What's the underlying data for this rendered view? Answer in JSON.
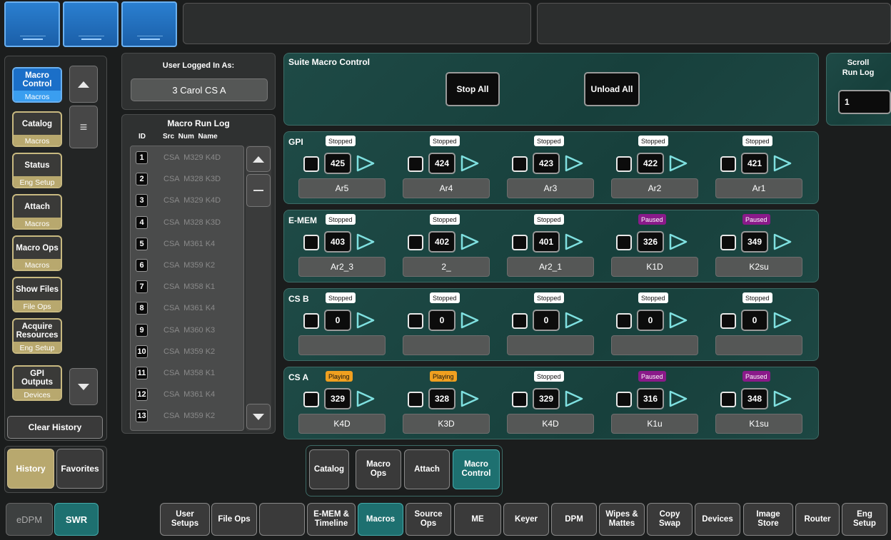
{
  "user_panel": {
    "title": "User Logged In As:",
    "user": "3 Carol  CS A"
  },
  "suite": {
    "title": "Suite Macro Control",
    "stop_all": "Stop All",
    "unload_all": "Unload All"
  },
  "scroll": {
    "title_1": "Scroll",
    "title_2": "Run Log",
    "value": "1"
  },
  "side_nav": [
    {
      "top": "Macro Control",
      "bottom": "Macros"
    },
    {
      "top": "Catalog",
      "bottom": "Macros"
    },
    {
      "top": "Status",
      "bottom": "Eng Setup"
    },
    {
      "top": "Attach",
      "bottom": "Macros"
    },
    {
      "top": "Macro Ops",
      "bottom": "Macros"
    },
    {
      "top": "Show Files",
      "bottom": "File Ops"
    },
    {
      "top": "Acquire Resources",
      "bottom": "Eng Setup"
    },
    {
      "top": "GPI Outputs",
      "bottom": "Devices"
    }
  ],
  "clear_history": "Clear History",
  "history_tab": "History",
  "favorites_tab": "Favorites",
  "mode": {
    "edpm": "eDPM",
    "swr": "SWR"
  },
  "log": {
    "title": "Macro Run Log",
    "col_id": "ID",
    "col_src_num_name": "Src  Num  Name",
    "rows": [
      {
        "id": "1",
        "text": "CSA  M329 K4D"
      },
      {
        "id": "2",
        "text": "CSA  M328 K3D"
      },
      {
        "id": "3",
        "text": "CSA  M329 K4D"
      },
      {
        "id": "4",
        "text": "CSA  M328 K3D"
      },
      {
        "id": "5",
        "text": "CSA  M361 K4"
      },
      {
        "id": "6",
        "text": "CSA  M359 K2"
      },
      {
        "id": "7",
        "text": "CSA  M358 K1"
      },
      {
        "id": "8",
        "text": "CSA  M361 K4"
      },
      {
        "id": "9",
        "text": "CSA  M360 K3"
      },
      {
        "id": "10",
        "text": "CSA  M359 K2"
      },
      {
        "id": "11",
        "text": "CSA  M358 K1"
      },
      {
        "id": "12",
        "text": "CSA  M361 K4"
      },
      {
        "id": "13",
        "text": "CSA  M359 K2"
      }
    ]
  },
  "groups": [
    {
      "label": "GPI",
      "slots": [
        {
          "status": "Stopped",
          "num": "425",
          "name": "Ar5"
        },
        {
          "status": "Stopped",
          "num": "424",
          "name": "Ar4"
        },
        {
          "status": "Stopped",
          "num": "423",
          "name": "Ar3"
        },
        {
          "status": "Stopped",
          "num": "422",
          "name": "Ar2"
        },
        {
          "status": "Stopped",
          "num": "421",
          "name": "Ar1"
        }
      ]
    },
    {
      "label": "E-MEM",
      "slots": [
        {
          "status": "Stopped",
          "num": "403",
          "name": "Ar2_3"
        },
        {
          "status": "Stopped",
          "num": "402",
          "name": "2_"
        },
        {
          "status": "Stopped",
          "num": "401",
          "name": "Ar2_1"
        },
        {
          "status": "Paused",
          "num": "326",
          "name": "K1D"
        },
        {
          "status": "Paused",
          "num": "349",
          "name": "K2su"
        }
      ]
    },
    {
      "label": "CS B",
      "slots": [
        {
          "status": "Stopped",
          "num": "0",
          "name": ""
        },
        {
          "status": "Stopped",
          "num": "0",
          "name": ""
        },
        {
          "status": "Stopped",
          "num": "0",
          "name": ""
        },
        {
          "status": "Stopped",
          "num": "0",
          "name": ""
        },
        {
          "status": "Stopped",
          "num": "0",
          "name": ""
        }
      ]
    },
    {
      "label": "CS A",
      "slots": [
        {
          "status": "Playing",
          "num": "329",
          "name": "K4D"
        },
        {
          "status": "Playing",
          "num": "328",
          "name": "K3D"
        },
        {
          "status": "Stopped",
          "num": "329",
          "name": "K4D"
        },
        {
          "status": "Paused",
          "num": "316",
          "name": "K1u"
        },
        {
          "status": "Paused",
          "num": "348",
          "name": "K1su"
        }
      ]
    }
  ],
  "sub_tabs": [
    {
      "label": "Catalog"
    },
    {
      "label": "Macro Ops"
    },
    {
      "label": "Attach"
    },
    {
      "label": "Macro Control"
    }
  ],
  "bottom_bar": [
    {
      "label": "User Setups"
    },
    {
      "label": "File Ops"
    },
    {
      "label": ""
    },
    {
      "label": "E-MEM & Timeline"
    },
    {
      "label": "Macros"
    },
    {
      "label": "Source Ops"
    },
    {
      "label": "ME"
    },
    {
      "label": "Keyer"
    },
    {
      "label": "DPM"
    },
    {
      "label": "Wipes & Mattes"
    },
    {
      "label": "Copy Swap"
    },
    {
      "label": "Devices"
    },
    {
      "label": "Image Store"
    },
    {
      "label": "Router"
    },
    {
      "label": "Eng Setup"
    }
  ],
  "colors": {
    "teal": "#1e4a46",
    "stopped": "#ffffff",
    "paused": "#8a1a8a",
    "playing": "#f0a020",
    "active_tab": "#1e7070"
  }
}
